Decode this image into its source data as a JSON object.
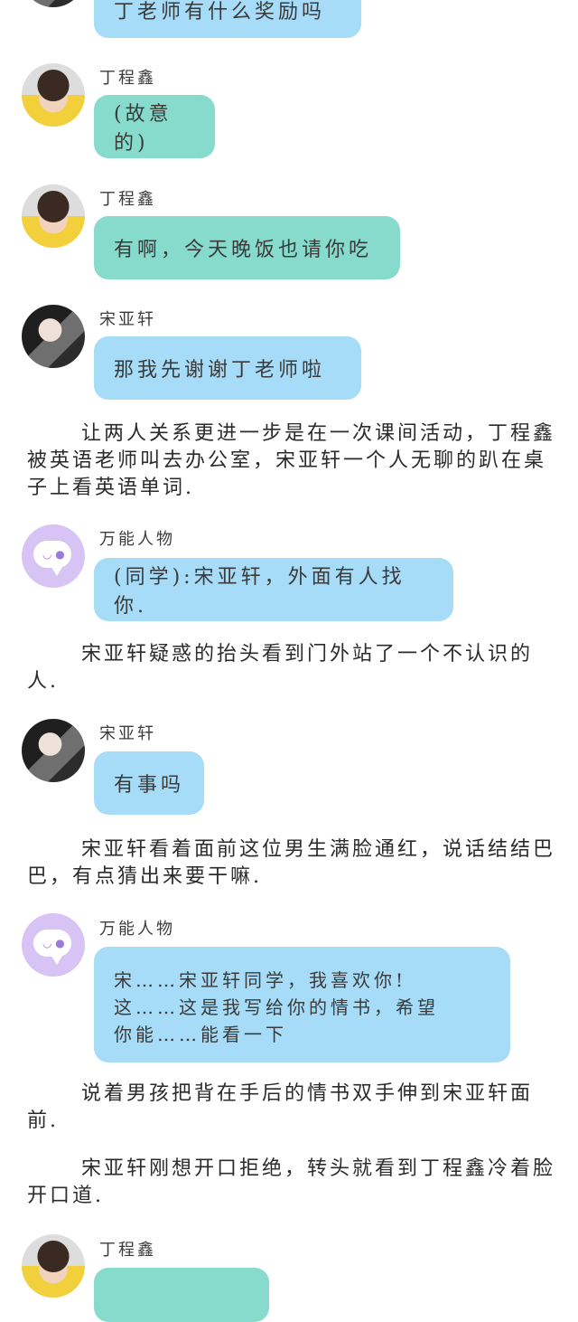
{
  "messages": [
    {
      "speaker": "",
      "text": "丁老师有什么奖励吗",
      "color": "blue"
    },
    {
      "speaker": "丁程鑫",
      "text": "(故意的)",
      "color": "teal"
    },
    {
      "speaker": "丁程鑫",
      "text": "有啊，今天晚饭也请你吃",
      "color": "teal"
    },
    {
      "speaker": "宋亚轩",
      "text": "那我先谢谢丁老师啦",
      "color": "blue"
    },
    {
      "speaker": "万能人物",
      "text": "(同学):宋亚轩，外面有人找你.",
      "color": "blue"
    },
    {
      "speaker": "宋亚轩",
      "text": "有事吗",
      "color": "blue"
    },
    {
      "speaker": "万能人物",
      "lines": [
        "宋……宋亚轩同学，我喜欢你!",
        "这……这是我写给你的情书，希望",
        "你能……能看一下"
      ],
      "color": "blue"
    },
    {
      "speaker": "丁程鑫",
      "text": "",
      "color": "teal"
    }
  ],
  "paragraphs": [
    "让两人关系更进一步是在一次课间活动，丁程鑫被英语老师叫去办公室，宋亚轩一个人无聊的趴在桌子上看英语单词.",
    "宋亚轩疑惑的抬头看到门外站了一个不认识的人.",
    "宋亚轩看着面前这位男生满脸通红，说话结结巴巴，有点猜出来要干嘛.",
    "说着男孩把背在手后的情书双手伸到宋亚轩面前.",
    "宋亚轩刚想开口拒绝，转头就看到丁程鑫冷着脸开口道."
  ],
  "colors": {
    "teal": "#86dbcd",
    "blue": "#a6dcf7",
    "avatar_purple": "#d7c4f4"
  }
}
